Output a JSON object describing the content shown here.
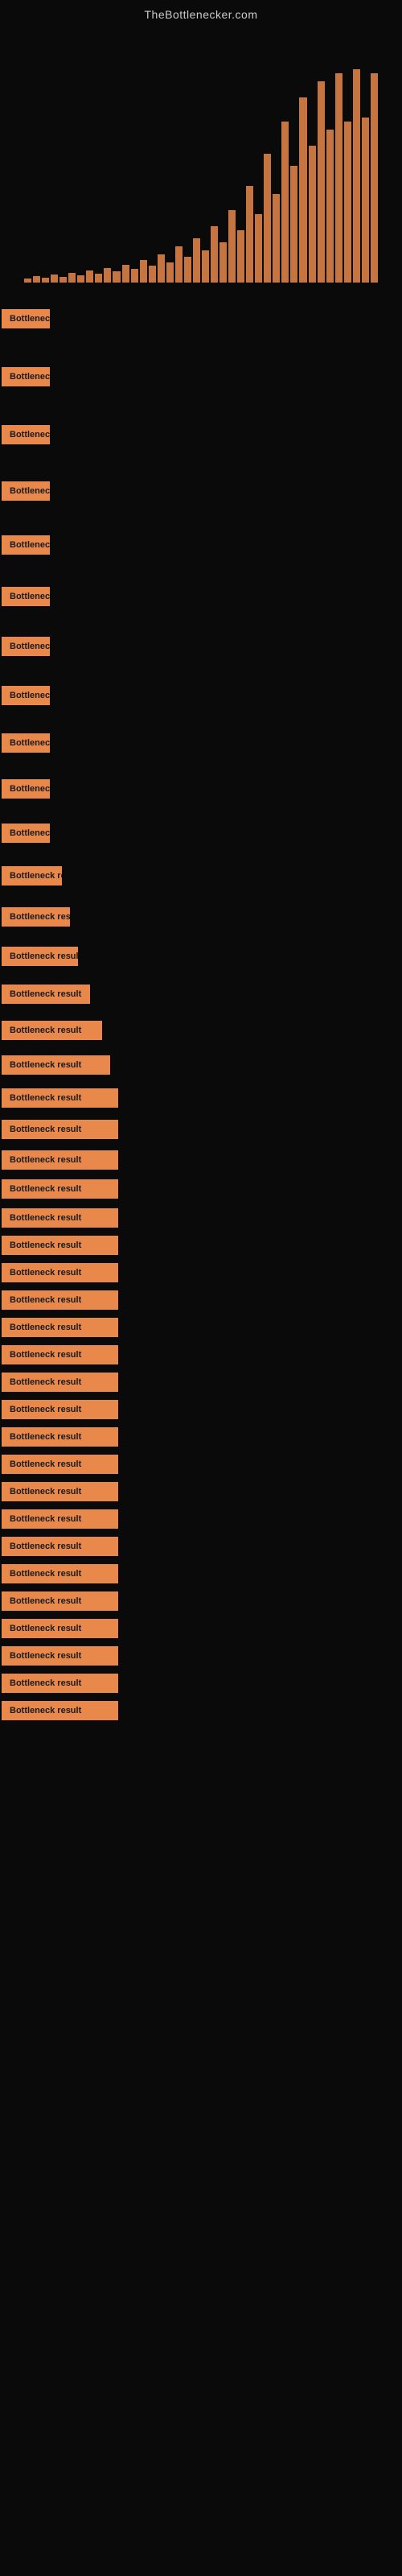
{
  "header": {
    "title": "TheBottlenecker.com"
  },
  "results": [
    {
      "label": "Bottleneck result",
      "widthClass": "badge-w1",
      "spacing": 60
    },
    {
      "label": "Bottleneck result",
      "widthClass": "badge-w1",
      "spacing": 60
    },
    {
      "label": "Bottleneck result",
      "widthClass": "badge-w1",
      "spacing": 60
    },
    {
      "label": "Bottleneck result",
      "widthClass": "badge-w1",
      "spacing": 55
    },
    {
      "label": "Bottleneck result",
      "widthClass": "badge-w2",
      "spacing": 55
    },
    {
      "label": "Bottleneck result",
      "widthClass": "badge-w3",
      "spacing": 50
    },
    {
      "label": "Bottleneck result",
      "widthClass": "badge-w4",
      "spacing": 50
    },
    {
      "label": "Bottleneck result",
      "widthClass": "badge-w5",
      "spacing": 48
    },
    {
      "label": "Bottleneck result",
      "widthClass": "badge-w6",
      "spacing": 46
    },
    {
      "label": "Bottleneck result",
      "widthClass": "badge-w7",
      "spacing": 44
    },
    {
      "label": "Bottleneck result",
      "widthClass": "badge-w8",
      "spacing": 42
    },
    {
      "label": "Bottleneck result",
      "widthClass": "badge-w9",
      "spacing": 40
    },
    {
      "label": "Bottleneck result",
      "widthClass": "badge-w10",
      "spacing": 38
    },
    {
      "label": "Bottleneck result",
      "widthClass": "badge-w11",
      "spacing": 36
    },
    {
      "label": "Bottleneck result",
      "widthClass": "badge-w12",
      "spacing": 34
    },
    {
      "label": "Bottleneck result",
      "widthClass": "badge-w13",
      "spacing": 32
    },
    {
      "label": "Bottleneck result",
      "widthClass": "badge-w14",
      "spacing": 30
    },
    {
      "label": "Bottleneck result",
      "widthClass": "badge-full",
      "spacing": 28
    },
    {
      "label": "Bottleneck result",
      "widthClass": "badge-full",
      "spacing": 26
    },
    {
      "label": "Bottleneck result",
      "widthClass": "badge-full",
      "spacing": 25
    },
    {
      "label": "Bottleneck result",
      "widthClass": "badge-full",
      "spacing": 24
    },
    {
      "label": "Bottleneck result",
      "widthClass": "badge-full",
      "spacing": 23
    },
    {
      "label": "Bottleneck result",
      "widthClass": "badge-full",
      "spacing": 22
    },
    {
      "label": "Bottleneck result",
      "widthClass": "badge-full",
      "spacing": 22
    },
    {
      "label": "Bottleneck result",
      "widthClass": "badge-full",
      "spacing": 21
    },
    {
      "label": "Bottleneck result",
      "widthClass": "badge-full",
      "spacing": 21
    },
    {
      "label": "Bottleneck result",
      "widthClass": "badge-full",
      "spacing": 20
    },
    {
      "label": "Bottleneck result",
      "widthClass": "badge-full",
      "spacing": 20
    },
    {
      "label": "Bottleneck result",
      "widthClass": "badge-full",
      "spacing": 20
    },
    {
      "label": "Bottleneck result",
      "widthClass": "badge-full",
      "spacing": 20
    },
    {
      "label": "Bottleneck result",
      "widthClass": "badge-full",
      "spacing": 20
    },
    {
      "label": "Bottleneck result",
      "widthClass": "badge-full",
      "spacing": 20
    },
    {
      "label": "Bottleneck result",
      "widthClass": "badge-full",
      "spacing": 20
    },
    {
      "label": "Bottleneck result",
      "widthClass": "badge-full",
      "spacing": 20
    },
    {
      "label": "Bottleneck result",
      "widthClass": "badge-full",
      "spacing": 20
    },
    {
      "label": "Bottleneck result",
      "widthClass": "badge-full",
      "spacing": 20
    },
    {
      "label": "Bottleneck result",
      "widthClass": "badge-full",
      "spacing": 20
    },
    {
      "label": "Bottleneck result",
      "widthClass": "badge-full",
      "spacing": 20
    },
    {
      "label": "Bottleneck result",
      "widthClass": "badge-full",
      "spacing": 20
    },
    {
      "label": "Bottleneck result",
      "widthClass": "badge-full",
      "spacing": 20
    }
  ],
  "bars": [
    5,
    8,
    6,
    10,
    7,
    12,
    9,
    15,
    11,
    18,
    14,
    22,
    17,
    28,
    21,
    35,
    25,
    45,
    32,
    55,
    40,
    70,
    50,
    90,
    65,
    120,
    85,
    160,
    110,
    200,
    145,
    230,
    170,
    250,
    190,
    260,
    200,
    265,
    205,
    260
  ]
}
